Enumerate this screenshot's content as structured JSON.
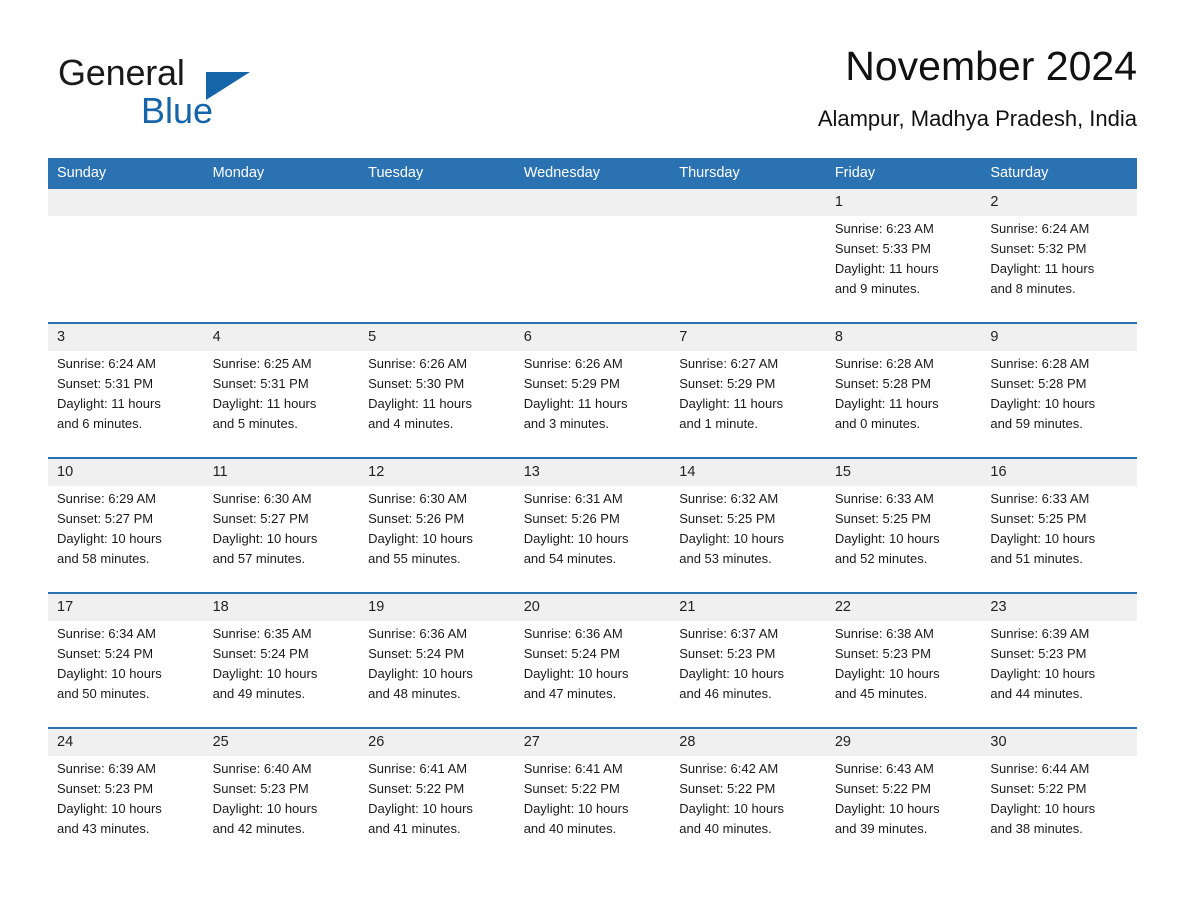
{
  "brand": {
    "name_part1": "General",
    "name_part2": "Blue",
    "triangle_color": "#1565a8"
  },
  "header": {
    "title": "November 2024",
    "subtitle": "Alampur, Madhya Pradesh, India"
  },
  "theme": {
    "header_blue": "#2b72b3",
    "daynum_band": "#f0f0f0",
    "text": "#1a1a1a"
  },
  "calendar": {
    "weekday_headers": [
      "Sunday",
      "Monday",
      "Tuesday",
      "Wednesday",
      "Thursday",
      "Friday",
      "Saturday"
    ],
    "weeks": [
      [
        {
          "day": "",
          "sunrise": "",
          "sunset": "",
          "daylight1": "",
          "daylight2": ""
        },
        {
          "day": "",
          "sunrise": "",
          "sunset": "",
          "daylight1": "",
          "daylight2": ""
        },
        {
          "day": "",
          "sunrise": "",
          "sunset": "",
          "daylight1": "",
          "daylight2": ""
        },
        {
          "day": "",
          "sunrise": "",
          "sunset": "",
          "daylight1": "",
          "daylight2": ""
        },
        {
          "day": "",
          "sunrise": "",
          "sunset": "",
          "daylight1": "",
          "daylight2": ""
        },
        {
          "day": "1",
          "sunrise": "Sunrise: 6:23 AM",
          "sunset": "Sunset: 5:33 PM",
          "daylight1": "Daylight: 11 hours",
          "daylight2": "and 9 minutes."
        },
        {
          "day": "2",
          "sunrise": "Sunrise: 6:24 AM",
          "sunset": "Sunset: 5:32 PM",
          "daylight1": "Daylight: 11 hours",
          "daylight2": "and 8 minutes."
        }
      ],
      [
        {
          "day": "3",
          "sunrise": "Sunrise: 6:24 AM",
          "sunset": "Sunset: 5:31 PM",
          "daylight1": "Daylight: 11 hours",
          "daylight2": "and 6 minutes."
        },
        {
          "day": "4",
          "sunrise": "Sunrise: 6:25 AM",
          "sunset": "Sunset: 5:31 PM",
          "daylight1": "Daylight: 11 hours",
          "daylight2": "and 5 minutes."
        },
        {
          "day": "5",
          "sunrise": "Sunrise: 6:26 AM",
          "sunset": "Sunset: 5:30 PM",
          "daylight1": "Daylight: 11 hours",
          "daylight2": "and 4 minutes."
        },
        {
          "day": "6",
          "sunrise": "Sunrise: 6:26 AM",
          "sunset": "Sunset: 5:29 PM",
          "daylight1": "Daylight: 11 hours",
          "daylight2": "and 3 minutes."
        },
        {
          "day": "7",
          "sunrise": "Sunrise: 6:27 AM",
          "sunset": "Sunset: 5:29 PM",
          "daylight1": "Daylight: 11 hours",
          "daylight2": "and 1 minute."
        },
        {
          "day": "8",
          "sunrise": "Sunrise: 6:28 AM",
          "sunset": "Sunset: 5:28 PM",
          "daylight1": "Daylight: 11 hours",
          "daylight2": "and 0 minutes."
        },
        {
          "day": "9",
          "sunrise": "Sunrise: 6:28 AM",
          "sunset": "Sunset: 5:28 PM",
          "daylight1": "Daylight: 10 hours",
          "daylight2": "and 59 minutes."
        }
      ],
      [
        {
          "day": "10",
          "sunrise": "Sunrise: 6:29 AM",
          "sunset": "Sunset: 5:27 PM",
          "daylight1": "Daylight: 10 hours",
          "daylight2": "and 58 minutes."
        },
        {
          "day": "11",
          "sunrise": "Sunrise: 6:30 AM",
          "sunset": "Sunset: 5:27 PM",
          "daylight1": "Daylight: 10 hours",
          "daylight2": "and 57 minutes."
        },
        {
          "day": "12",
          "sunrise": "Sunrise: 6:30 AM",
          "sunset": "Sunset: 5:26 PM",
          "daylight1": "Daylight: 10 hours",
          "daylight2": "and 55 minutes."
        },
        {
          "day": "13",
          "sunrise": "Sunrise: 6:31 AM",
          "sunset": "Sunset: 5:26 PM",
          "daylight1": "Daylight: 10 hours",
          "daylight2": "and 54 minutes."
        },
        {
          "day": "14",
          "sunrise": "Sunrise: 6:32 AM",
          "sunset": "Sunset: 5:25 PM",
          "daylight1": "Daylight: 10 hours",
          "daylight2": "and 53 minutes."
        },
        {
          "day": "15",
          "sunrise": "Sunrise: 6:33 AM",
          "sunset": "Sunset: 5:25 PM",
          "daylight1": "Daylight: 10 hours",
          "daylight2": "and 52 minutes."
        },
        {
          "day": "16",
          "sunrise": "Sunrise: 6:33 AM",
          "sunset": "Sunset: 5:25 PM",
          "daylight1": "Daylight: 10 hours",
          "daylight2": "and 51 minutes."
        }
      ],
      [
        {
          "day": "17",
          "sunrise": "Sunrise: 6:34 AM",
          "sunset": "Sunset: 5:24 PM",
          "daylight1": "Daylight: 10 hours",
          "daylight2": "and 50 minutes."
        },
        {
          "day": "18",
          "sunrise": "Sunrise: 6:35 AM",
          "sunset": "Sunset: 5:24 PM",
          "daylight1": "Daylight: 10 hours",
          "daylight2": "and 49 minutes."
        },
        {
          "day": "19",
          "sunrise": "Sunrise: 6:36 AM",
          "sunset": "Sunset: 5:24 PM",
          "daylight1": "Daylight: 10 hours",
          "daylight2": "and 48 minutes."
        },
        {
          "day": "20",
          "sunrise": "Sunrise: 6:36 AM",
          "sunset": "Sunset: 5:24 PM",
          "daylight1": "Daylight: 10 hours",
          "daylight2": "and 47 minutes."
        },
        {
          "day": "21",
          "sunrise": "Sunrise: 6:37 AM",
          "sunset": "Sunset: 5:23 PM",
          "daylight1": "Daylight: 10 hours",
          "daylight2": "and 46 minutes."
        },
        {
          "day": "22",
          "sunrise": "Sunrise: 6:38 AM",
          "sunset": "Sunset: 5:23 PM",
          "daylight1": "Daylight: 10 hours",
          "daylight2": "and 45 minutes."
        },
        {
          "day": "23",
          "sunrise": "Sunrise: 6:39 AM",
          "sunset": "Sunset: 5:23 PM",
          "daylight1": "Daylight: 10 hours",
          "daylight2": "and 44 minutes."
        }
      ],
      [
        {
          "day": "24",
          "sunrise": "Sunrise: 6:39 AM",
          "sunset": "Sunset: 5:23 PM",
          "daylight1": "Daylight: 10 hours",
          "daylight2": "and 43 minutes."
        },
        {
          "day": "25",
          "sunrise": "Sunrise: 6:40 AM",
          "sunset": "Sunset: 5:23 PM",
          "daylight1": "Daylight: 10 hours",
          "daylight2": "and 42 minutes."
        },
        {
          "day": "26",
          "sunrise": "Sunrise: 6:41 AM",
          "sunset": "Sunset: 5:22 PM",
          "daylight1": "Daylight: 10 hours",
          "daylight2": "and 41 minutes."
        },
        {
          "day": "27",
          "sunrise": "Sunrise: 6:41 AM",
          "sunset": "Sunset: 5:22 PM",
          "daylight1": "Daylight: 10 hours",
          "daylight2": "and 40 minutes."
        },
        {
          "day": "28",
          "sunrise": "Sunrise: 6:42 AM",
          "sunset": "Sunset: 5:22 PM",
          "daylight1": "Daylight: 10 hours",
          "daylight2": "and 40 minutes."
        },
        {
          "day": "29",
          "sunrise": "Sunrise: 6:43 AM",
          "sunset": "Sunset: 5:22 PM",
          "daylight1": "Daylight: 10 hours",
          "daylight2": "and 39 minutes."
        },
        {
          "day": "30",
          "sunrise": "Sunrise: 6:44 AM",
          "sunset": "Sunset: 5:22 PM",
          "daylight1": "Daylight: 10 hours",
          "daylight2": "and 38 minutes."
        }
      ]
    ]
  }
}
